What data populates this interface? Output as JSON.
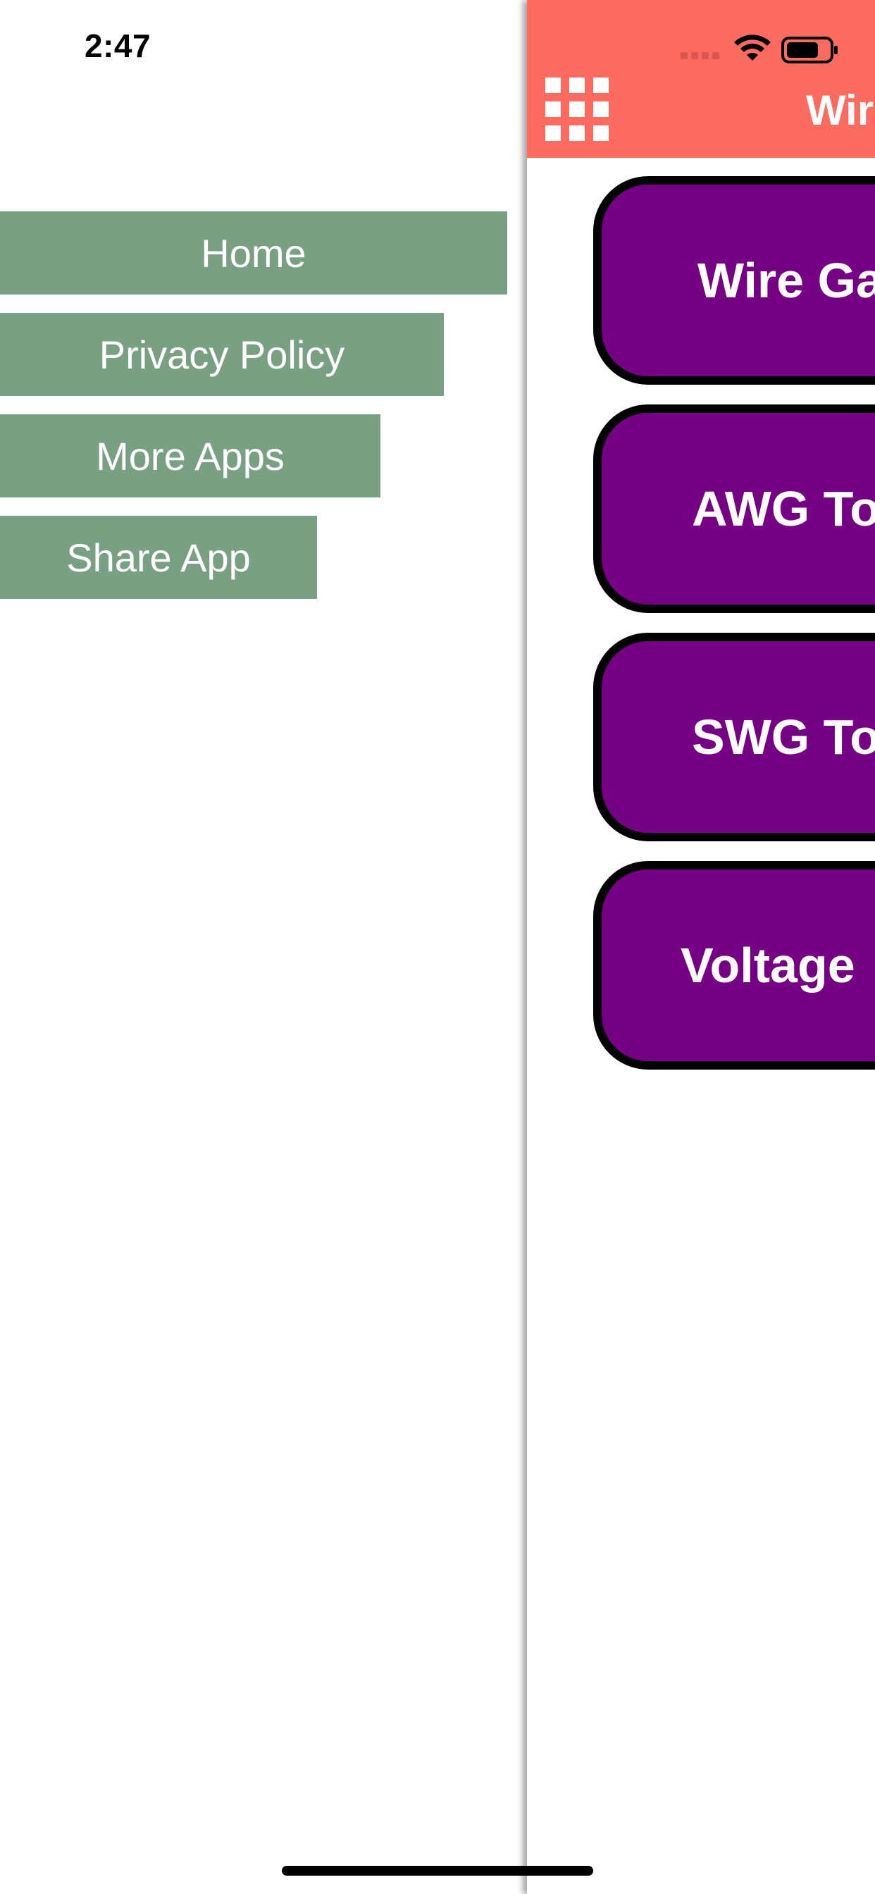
{
  "status_bar": {
    "time": "2:47"
  },
  "drawer": {
    "items": [
      {
        "label": "Home"
      },
      {
        "label": "Privacy Policy"
      },
      {
        "label": "More Apps"
      },
      {
        "label": "Share App"
      }
    ],
    "item_color": "#7aa084"
  },
  "main": {
    "app_bar": {
      "title": "Wir",
      "menu_icon": "grid-icon",
      "color": "#fb6b60"
    },
    "buttons": [
      {
        "label": "Wire Ga"
      },
      {
        "label": "AWG To"
      },
      {
        "label": "SWG To"
      },
      {
        "label": "Voltage"
      }
    ],
    "button_color": "#760083",
    "button_border_color": "#000000"
  }
}
